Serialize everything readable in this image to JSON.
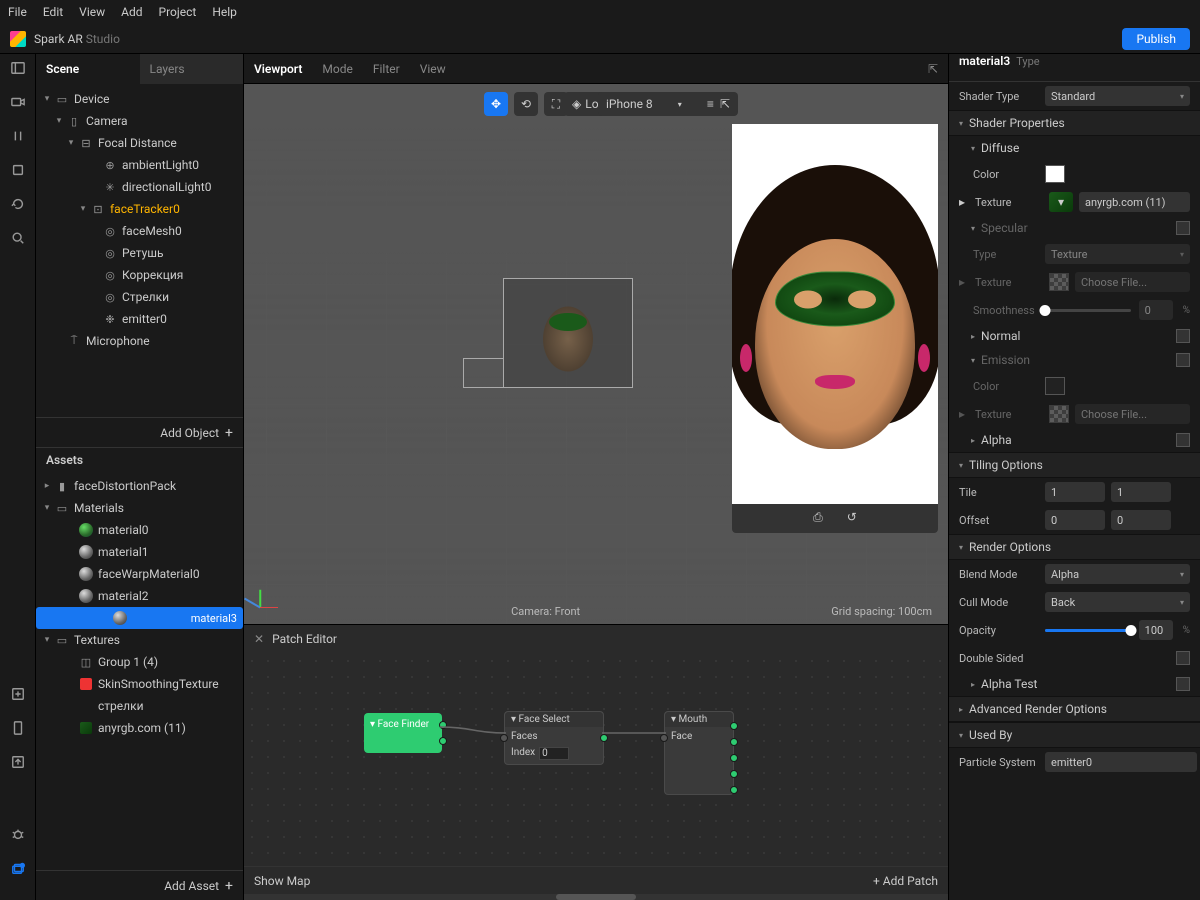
{
  "menu": {
    "items": [
      "File",
      "Edit",
      "View",
      "Add",
      "Project",
      "Help"
    ]
  },
  "app": {
    "name": "Spark AR",
    "suffix": "Studio",
    "publish": "Publish"
  },
  "leftTabs": {
    "scene": "Scene",
    "layers": "Layers"
  },
  "sceneTree": [
    {
      "pad": 0,
      "tw": "▾",
      "icon": "device",
      "label": "Device"
    },
    {
      "pad": 1,
      "tw": "▾",
      "icon": "camera",
      "label": "Camera"
    },
    {
      "pad": 2,
      "tw": "▾",
      "icon": "focal",
      "label": "Focal Distance"
    },
    {
      "pad": 4,
      "tw": "",
      "icon": "globe",
      "label": "ambientLight0"
    },
    {
      "pad": 4,
      "tw": "",
      "icon": "sun",
      "label": "directionalLight0"
    },
    {
      "pad": 3,
      "tw": "▾",
      "icon": "face",
      "label": "faceTracker0",
      "warn": true
    },
    {
      "pad": 4,
      "tw": "",
      "icon": "mesh",
      "label": "faceMesh0"
    },
    {
      "pad": 4,
      "tw": "",
      "icon": "mesh",
      "label": "Ретушь"
    },
    {
      "pad": 4,
      "tw": "",
      "icon": "mesh",
      "label": "Коррекция"
    },
    {
      "pad": 4,
      "tw": "",
      "icon": "mesh",
      "label": "Стрелки"
    },
    {
      "pad": 4,
      "tw": "",
      "icon": "emitter",
      "label": "emitter0"
    },
    {
      "pad": 1,
      "tw": "",
      "icon": "mic",
      "label": "Microphone"
    }
  ],
  "addObject": "Add Object",
  "assetsHeader": "Assets",
  "assetsTree": [
    {
      "pad": 0,
      "tw": "▸",
      "icon": "file",
      "label": "faceDistortionPack"
    },
    {
      "pad": 0,
      "tw": "▾",
      "icon": "folder",
      "label": "Materials"
    },
    {
      "pad": 2,
      "tw": "",
      "icon": "mat-green",
      "label": "material0"
    },
    {
      "pad": 2,
      "tw": "",
      "icon": "sphere",
      "label": "material1"
    },
    {
      "pad": 2,
      "tw": "",
      "icon": "sphere",
      "label": "faceWarpMaterial0"
    },
    {
      "pad": 2,
      "tw": "",
      "icon": "sphere",
      "label": "material2"
    },
    {
      "pad": 2,
      "tw": "",
      "icon": "sphere",
      "label": "material3",
      "sel": true
    },
    {
      "pad": 0,
      "tw": "▾",
      "icon": "folder",
      "label": "Textures"
    },
    {
      "pad": 2,
      "tw": "",
      "icon": "tex",
      "label": "Group 1 (4)"
    },
    {
      "pad": 2,
      "tw": "",
      "icon": "tex-red",
      "label": "SkinSmoothingTexture"
    },
    {
      "pad": 2,
      "tw": "",
      "icon": "none",
      "label": "стрелки"
    },
    {
      "pad": 2,
      "tw": "",
      "icon": "tex-g",
      "label": "anyrgb.com (11)"
    }
  ],
  "addAsset": "Add Asset",
  "viewportTabs": {
    "viewport": "Viewport",
    "mode": "Mode",
    "filter": "Filter",
    "view": "View"
  },
  "toolbar": {
    "local": "Local",
    "pivot": "Pivot"
  },
  "device": "iPhone 8",
  "viewportFooter": {
    "camera": "Camera: Front",
    "grid": "Grid spacing: 100cm"
  },
  "patch": {
    "title": "Patch Editor",
    "showMap": "Show Map",
    "addPatch": "Add Patch",
    "nodes": {
      "finder": "Face Finder",
      "select": {
        "title": "Face Select",
        "row1": "Faces",
        "row2": "Index",
        "index": "0"
      },
      "mouth": {
        "title": "Mouth",
        "row1": "Face"
      }
    }
  },
  "inspector": {
    "name": "material3",
    "type": "Type",
    "shaderType": {
      "label": "Shader Type",
      "value": "Standard"
    },
    "sections": {
      "shaderProps": "Shader Properties",
      "diffuse": "Diffuse",
      "specular": "Specular",
      "normal": "Normal",
      "emission": "Emission",
      "alpha": "Alpha",
      "tiling": "Tiling Options",
      "render": "Render Options",
      "alphaTest": "Alpha Test",
      "advanced": "Advanced Render Options",
      "usedBy": "Used By"
    },
    "color": "Color",
    "texture": "Texture",
    "textureVal": "anyrgb.com (11)",
    "typeVal": "Texture",
    "chooseFile": "Choose File...",
    "smoothness": "Smoothness",
    "smoothnessVal": "0",
    "tile": "Tile",
    "tileX": "1",
    "tileY": "1",
    "offset": "Offset",
    "offsetX": "0",
    "offsetY": "0",
    "blendMode": "Blend Mode",
    "blendVal": "Alpha",
    "cullMode": "Cull Mode",
    "cullVal": "Back",
    "opacity": "Opacity",
    "opacityVal": "100",
    "doubleSided": "Double Sided",
    "particle": "Particle System",
    "particleVal": "emitter0"
  }
}
